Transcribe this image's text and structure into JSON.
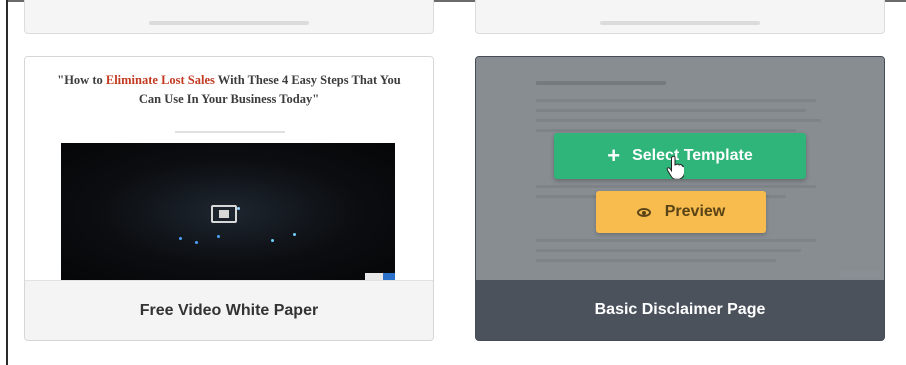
{
  "cards": [
    {
      "caption": "Free Video White Paper",
      "headline_prefix": "\"How to ",
      "headline_highlight": "Eliminate Lost Sales",
      "headline_suffix": " With These 4 Easy Steps That You Can Use In Your Business Today\""
    },
    {
      "caption": "Basic Disclaimer Page",
      "select_label": "Select Template",
      "preview_label": "Preview",
      "select_icon": "plus-icon",
      "preview_icon": "eye-icon"
    }
  ],
  "colors": {
    "select_button": "#2fb479",
    "preview_button": "#f7bc4d",
    "card_hover_caption": "#4b525c",
    "headline_highlight": "#c23b22"
  }
}
